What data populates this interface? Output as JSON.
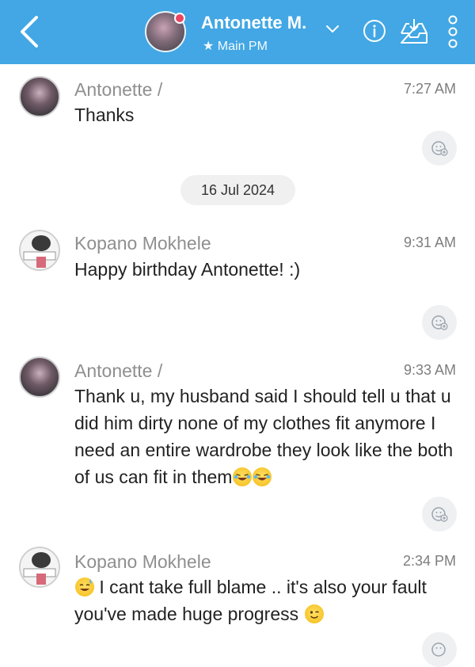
{
  "header": {
    "contact_name": "Antonette M.",
    "subtitle": "★ Main PM",
    "accent_color": "#42a7e4",
    "online_color": "#e94560"
  },
  "icons": {
    "back": "chevron-left-icon",
    "dropdown": "chevron-down-icon",
    "info": "info-icon",
    "inbox": "inbox-tray-icon",
    "more": "more-vertical-icon",
    "reaction": "add-reaction-icon",
    "laugh_emoji": "laughing-tears-emoji",
    "sweat_emoji": "grinning-sweat-emoji",
    "wink_emoji": "wink-emoji"
  },
  "messages": [
    {
      "sender": "Antonette /",
      "time": "7:27 AM",
      "text": "Thanks"
    },
    {
      "sender": "Kopano Mokhele",
      "time": "9:31 AM",
      "text": "Happy birthday Antonette! :)"
    },
    {
      "sender": "Antonette /",
      "time": "9:33 AM",
      "text": "Thank u, my husband said I should tell u that u did him dirty none of my clothes fit anymore I need an entire wardrobe they look like the both of us can fit in them"
    },
    {
      "sender": "Kopano Mokhele",
      "time": "2:34 PM",
      "text": " I cant take full blame .. it's also your fault you've made huge progress "
    }
  ],
  "date_separator": "16 Jul 2024"
}
